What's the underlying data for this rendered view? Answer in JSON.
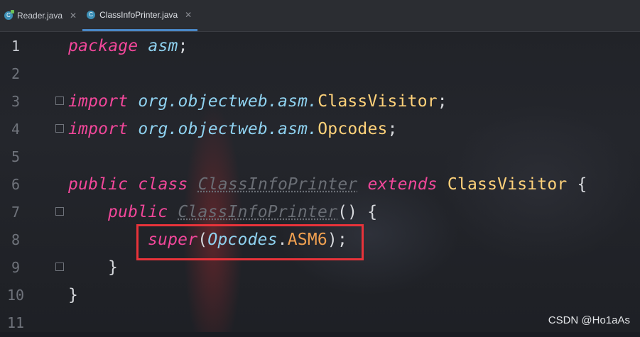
{
  "tabs": [
    {
      "label": "Reader.java",
      "active": false,
      "icon": "java-class-icon"
    },
    {
      "label": "ClassInfoPrinter.java",
      "active": true,
      "icon": "java-class-icon"
    }
  ],
  "line_numbers": [
    "1",
    "2",
    "3",
    "4",
    "5",
    "6",
    "7",
    "8",
    "9",
    "10",
    "11"
  ],
  "code": {
    "l1": {
      "kw": "package",
      "pkg": "asm",
      "semi": ";"
    },
    "l3": {
      "kw": "import",
      "pkg": "org.objectweb.asm.",
      "type": "ClassVisitor",
      "semi": ";"
    },
    "l4": {
      "kw": "import",
      "pkg": "org.objectweb.asm.",
      "type": "Opcodes",
      "semi": ";"
    },
    "l6": {
      "kw1": "public",
      "kw2": "class",
      "name": "ClassInfoPrinter",
      "kw3": "extends",
      "type": "ClassVisitor",
      "brace": "{"
    },
    "l7": {
      "kw": "public",
      "name": "ClassInfoPrinter",
      "rest": "() {"
    },
    "l8": {
      "kw": "super",
      "open": "(",
      "cls": "Opcodes",
      "dot": ".",
      "const": "ASM6",
      "close": ");"
    },
    "l9": {
      "brace": "}"
    },
    "l10": {
      "brace": "}"
    }
  },
  "watermark": "CSDN @Ho1aAs",
  "colors": {
    "highlight": "#e8333a",
    "keyword": "#f2479a",
    "type": "#ffd27a"
  }
}
